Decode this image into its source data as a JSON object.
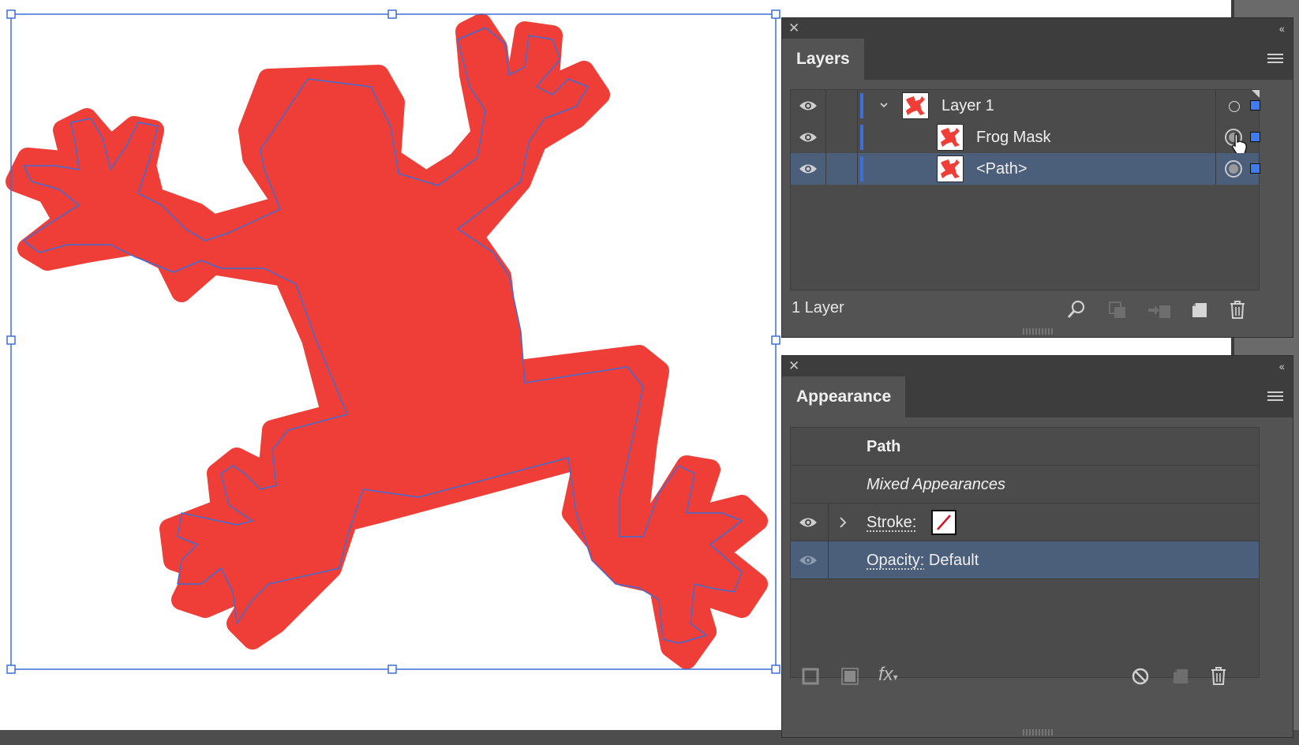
{
  "colors": {
    "frog_fill": "#ef3e38",
    "selection": "#3d6fd6",
    "panel_bg": "#535353",
    "selected_row": "#4b5f7a"
  },
  "layers_panel": {
    "tab_label": "Layers",
    "close_icon": "close-icon",
    "collapse_icon": "double-chevron-left-icon",
    "menu_icon": "panel-menu-icon",
    "rows": [
      {
        "name": "Layer 1",
        "visible": true,
        "expanded": true,
        "selected": false
      },
      {
        "name": "Frog Mask",
        "visible": true,
        "selected": false
      },
      {
        "name": "<Path>",
        "visible": true,
        "selected": true
      }
    ],
    "footer_count": "1 Layer",
    "footer_icons": [
      "search-icon",
      "make-clipping-mask-icon",
      "move-to-layer-icon",
      "new-layer-icon",
      "trash-icon"
    ]
  },
  "appearance_panel": {
    "tab_label": "Appearance",
    "close_icon": "close-icon",
    "collapse_icon": "double-chevron-left-icon",
    "menu_icon": "panel-menu-icon",
    "object_type": "Path",
    "mixed_label": "Mixed Appearances",
    "stroke_label": "Stroke:",
    "stroke_value": "none",
    "opacity_label": "Opacity:",
    "opacity_value": "Default",
    "footer_icons": [
      "add-stroke-icon",
      "add-fill-icon",
      "fx-icon",
      "clear-appearance-icon",
      "duplicate-item-icon",
      "trash-icon"
    ],
    "fx_label": "fx"
  }
}
